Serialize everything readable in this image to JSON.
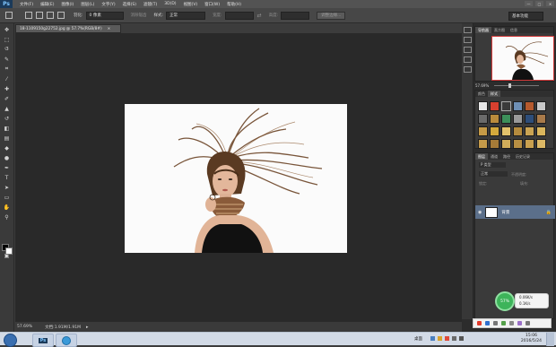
{
  "app": {
    "logo": "Ps"
  },
  "menubar": {
    "items": [
      "文件(F)",
      "编辑(E)",
      "图像(I)",
      "图层(L)",
      "文字(Y)",
      "选择(S)",
      "滤镜(T)",
      "3D(D)",
      "视图(V)",
      "窗口(W)",
      "帮助(H)"
    ],
    "window_controls": [
      "—",
      "□",
      "✕"
    ]
  },
  "options": {
    "feather_label": "羽化:",
    "feather_value": "0 像素",
    "antialias_label": "消除锯齿",
    "style_label": "样式:",
    "style_value": "正常",
    "width_label": "宽度:",
    "height_label": "高度:",
    "refine_button": "调整边缘...",
    "workspace": "基本功能"
  },
  "document": {
    "tab_title": "18-1109150g22752.jpg @ 57.7%(RGB/8#)",
    "close_glyph": "×"
  },
  "status": {
    "zoom": "57.69%",
    "doc_info": "文档:1.91M/1.91M"
  },
  "panels": {
    "navigator_tabs": [
      "导航器",
      "直方图",
      "信息"
    ],
    "nav_zoom": "57.69%",
    "style_tabs": [
      "颜色",
      "样式"
    ],
    "layer_tabs": [
      "图层",
      "通道",
      "路径",
      "历史记录"
    ],
    "layer_kind": "P 类型",
    "blend_mode": "正常",
    "opacity_label": "不透明度:",
    "lock_label": "锁定:",
    "fill_label": "填充:",
    "layer_name": "背景"
  },
  "network_widget": {
    "percent": "57%",
    "up": "0.06K/s",
    "down": "0.1K/s"
  },
  "taskbar": {
    "tray_label": "桌面",
    "time": "15:06",
    "date": "2016/5/24",
    "ps_app": "Ps"
  }
}
